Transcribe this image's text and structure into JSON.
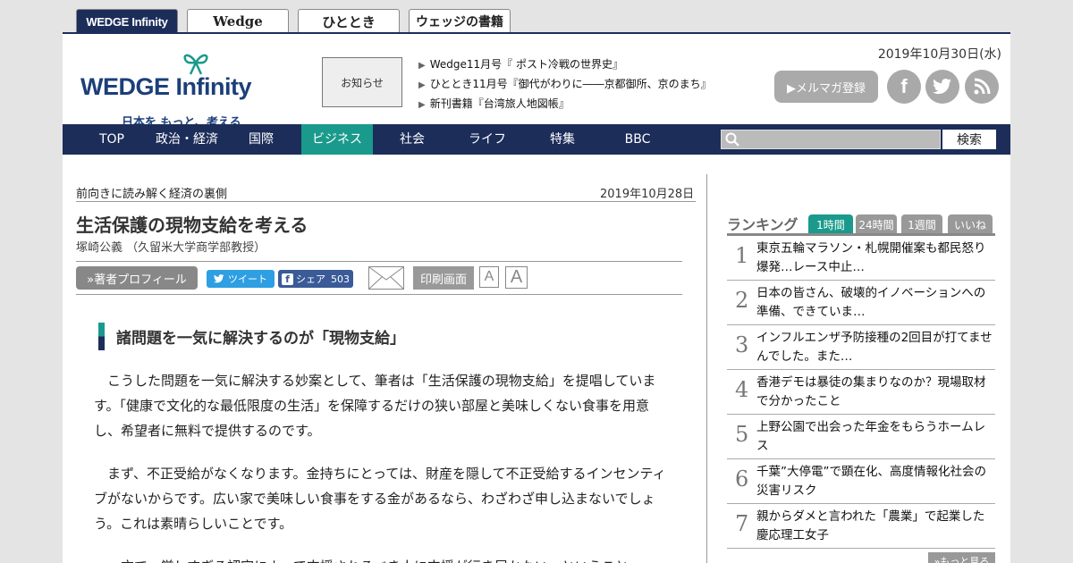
{
  "site_tabs": [
    "WEDGE Infinity",
    "Wedge",
    "ひととき",
    "ウェッジの書籍"
  ],
  "logo": {
    "text_a": "WEDGE",
    "text_b": "Infinity",
    "tagline": "日本を もっと、考える"
  },
  "notice_label": "お知らせ",
  "news": [
    "Wedge11月号『 ポスト冷戦の世界史』",
    "ひととき11月号『御代がわりに――京都御所、京のまち』",
    "新刊書籍『台湾旅人地図帳』"
  ],
  "date_top": "2019年10月30日(水)",
  "mailmag_label": "▶メルマガ登録",
  "social": [
    "facebook-icon",
    "twitter-icon",
    "rss-icon"
  ],
  "nav": [
    "TOP",
    "政治・経済",
    "国際",
    "ビジネス",
    "社会",
    "ライフ",
    "特集",
    "BBC"
  ],
  "search": {
    "placeholder": "",
    "button": "検索"
  },
  "article": {
    "series": "前向きに読み解く経済の裏側",
    "date": "2019年10月28日",
    "title": "生活保護の現物支給を考える",
    "author": "塚崎公義 （久留米大学商学部教授）",
    "profile_button": "»著者プロフィール",
    "tweet_label": "ツイート",
    "share_label": "シェア",
    "share_count": "503",
    "print_label": "印刷画面",
    "font_small": "A",
    "font_large": "A",
    "subhead": "諸問題を一気に解決するのが「現物支給」",
    "paragraphs": [
      "　こうした問題を一気に解決する妙案として、筆者は「生活保護の現物支給」を提唱しています。「健康で文化的な最低限度の生活」を保障するだけの狭い部屋と美味しくない食事を用意し、希望者に無料で提供するのです。",
      "　まず、不正受給がなくなります。金持ちにとっては、財産を隠して不正受給するインセンティブがないからです。広い家で美味しい食事をする金があるなら、わざわざ申し込まないでしょう。これは素晴らしいことです。",
      "　一方で、厳しすぎる認定によって支援されるべき人に支援が行き届かない、ということ"
    ]
  },
  "ranking": {
    "title": "ランキング",
    "tabs": [
      "1時間",
      "24時間",
      "1週間",
      "いいね"
    ],
    "items": [
      {
        "num": "1",
        "text": "東京五輪マラソン・札幌開催案も都民怒り爆発…レース中止…"
      },
      {
        "num": "2",
        "text": "日本の皆さん、破壊的イノベーションへの準備、できていま…"
      },
      {
        "num": "3",
        "text": "インフルエンザ予防接種の2回目が打てませんでした。また…"
      },
      {
        "num": "4",
        "text": "香港デモは暴徒の集まりなのか？現場取材で分かったこと"
      },
      {
        "num": "5",
        "text": "上野公園で出会った年金をもらうホームレス"
      },
      {
        "num": "6",
        "text": "千葉”大停電”で顕在化、高度情報化社会の災害リスク"
      },
      {
        "num": "7",
        "text": "親からダメと言われた「農業」で起業した慶応理工女子"
      }
    ],
    "more": "»もっと見る"
  }
}
